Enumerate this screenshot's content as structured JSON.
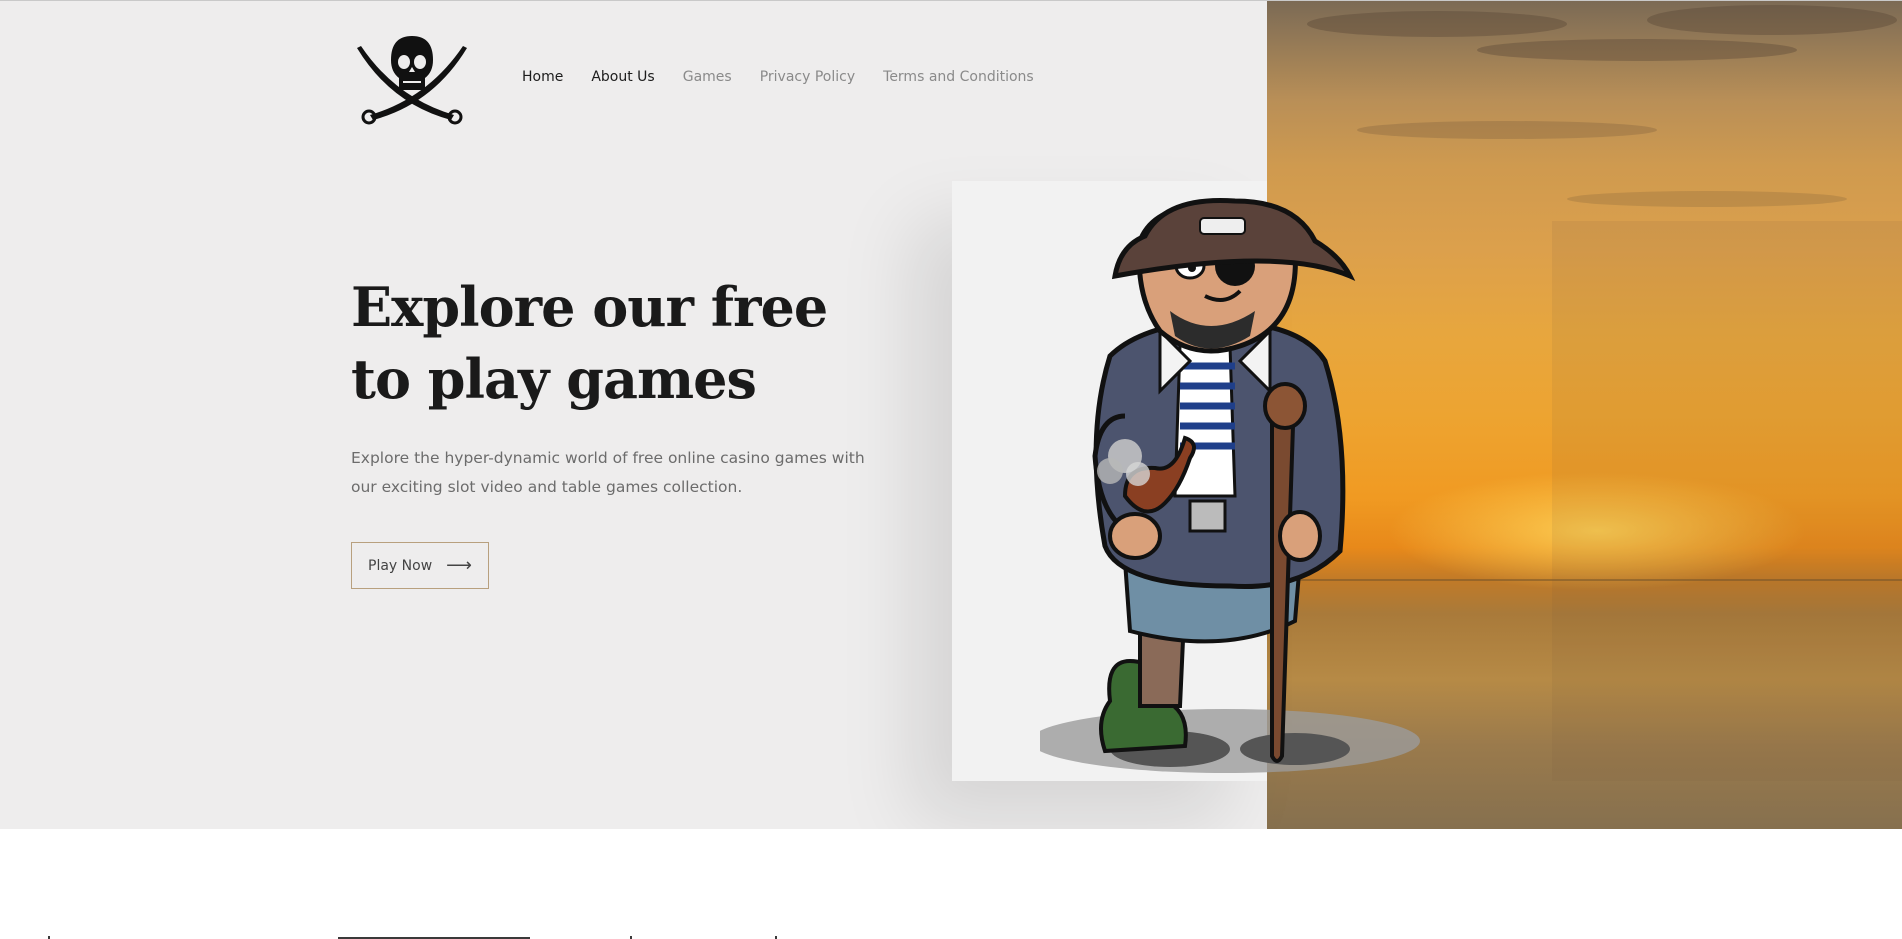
{
  "nav": {
    "items": [
      {
        "label": "Home"
      },
      {
        "label": "About Us"
      },
      {
        "label": "Games"
      },
      {
        "label": "Privacy Policy"
      },
      {
        "label": "Terms and Conditions"
      }
    ]
  },
  "hero": {
    "headline": "Explore our free to play games",
    "subtext": "Explore the hyper-dynamic world of free online casino games with our exciting slot video and table games collection.",
    "cta_label": "Play Now",
    "cta_arrow": "⟶"
  },
  "colors": {
    "hero_background": "#eeeded",
    "button_border": "#b8a07e",
    "headline": "#1a1a1a",
    "nav_active": "#1c1c1c",
    "nav_muted": "#8a8a8a"
  },
  "icons": [
    "skull-crossed-swords-logo-icon",
    "right-arrow-icon"
  ]
}
